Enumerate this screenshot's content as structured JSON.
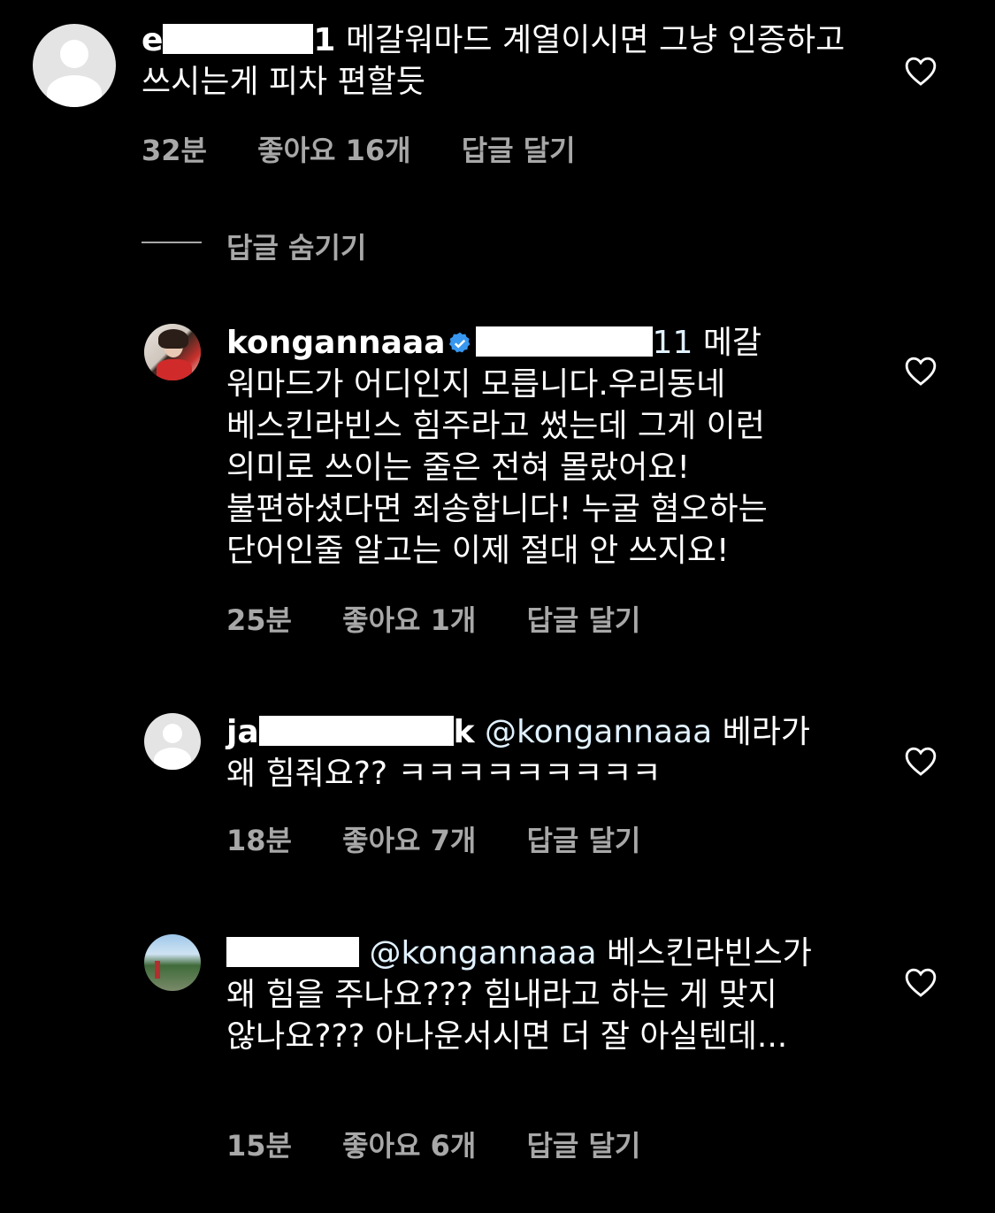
{
  "comments": [
    {
      "username_visible": "e",
      "username_suffix": "1",
      "text": "메갈워마드 계열이시면 그냥 인증하고 쓰시는게 피차 편할듯",
      "time": "32분",
      "likes": "좋아요 16개",
      "reply": "답글 달기"
    },
    {
      "username": "kongannaaa",
      "verified": true,
      "mention_suffix": "11",
      "text": "메갈 워마드가 어디인지 모릅니다.우리동네 베스킨라빈스 힘주라고 썼는데 그게 이런 의미로 쓰이는 줄은 전혀 몰랐어요! 불편하셨다면 죄송합니다! 누굴 혐오하는 단어인줄 알고는 이제 절대 안 쓰지요!",
      "time": "25분",
      "likes": "좋아요 1개",
      "reply": "답글 달기"
    },
    {
      "username_prefix": "ja",
      "username_suffix": "k",
      "mention": "@kongannaaa",
      "text": "베라가 왜 힘줘요?? ㅋㅋㅋㅋㅋㅋㅋㅋㅋ",
      "time": "18분",
      "likes": "좋아요 7개",
      "reply": "답글 달기"
    },
    {
      "mention": "@kongannaaa",
      "text": "베스킨라빈스가 왜 힘을 주나요??? 힘내라고 하는 게 맞지 않나요??? 아나운서시면 더 잘 아실텐데...",
      "time": "15분",
      "likes": "좋아요 6개",
      "reply": "답글 달기"
    }
  ],
  "hide_replies": "답글 숨기기",
  "icons": {
    "like": "heart-outline-icon",
    "verified": "verified-badge-icon"
  },
  "colors": {
    "background": "#000000",
    "text": "#ffffff",
    "meta": "#a8a8a8",
    "verified": "#3897f0"
  }
}
